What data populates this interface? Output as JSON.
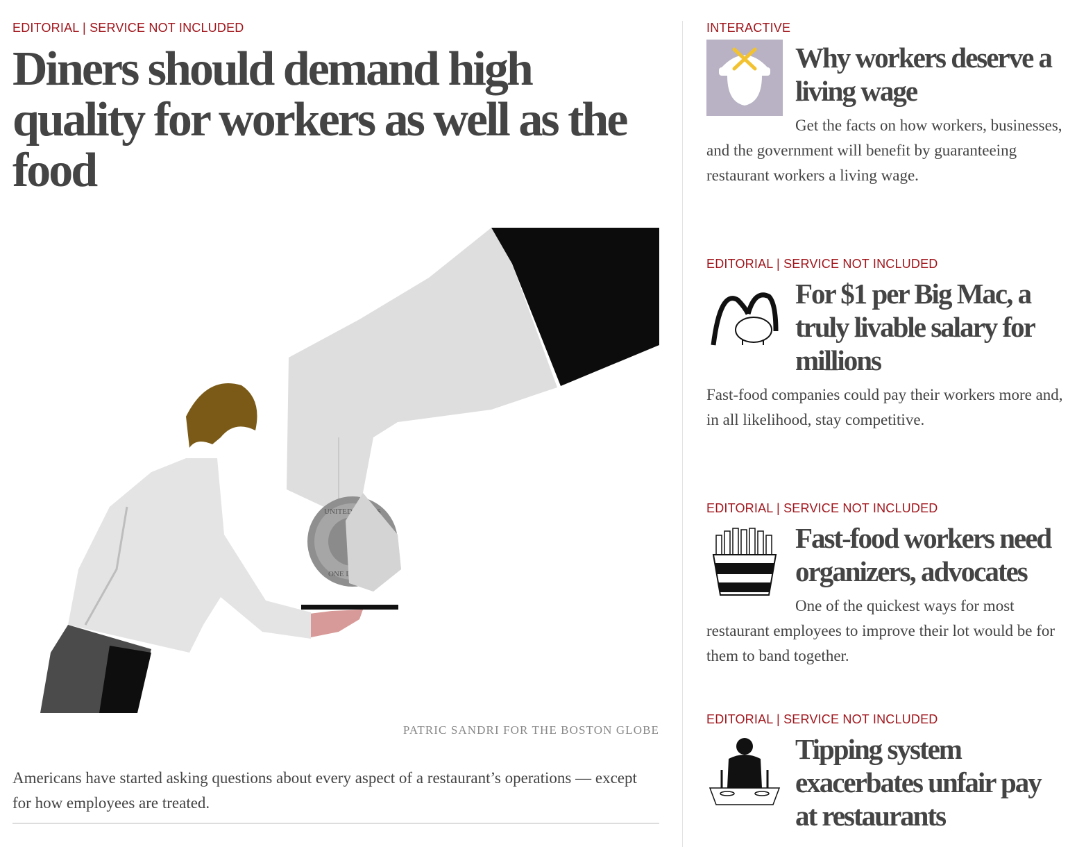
{
  "main": {
    "kicker": "EDITORIAL | SERVICE NOT INCLUDED",
    "headline": "Diners should demand high quality for workers as well as the food",
    "credit": "PATRIC SANDRI FOR THE BOSTON GLOBE",
    "summary": "Americans have started asking questions about every aspect of a restaurant’s operations — except for how employees are treated.",
    "coin_top": "UNITED STATES",
    "coin_bottom": "ONE DOLLAR"
  },
  "sidebar": [
    {
      "kicker": "INTERACTIVE",
      "title": "Why workers deserve a living wage",
      "blurb": "Get the facts on how workers, businesses, and the government will benefit by guaranteeing restaurant workers a living wage."
    },
    {
      "kicker": "EDITORIAL | SERVICE NOT INCLUDED",
      "title": "For $1 per Big Mac, a truly livable salary for millions",
      "blurb": "Fast-food companies could pay their workers more and, in all likelihood, stay competitive."
    },
    {
      "kicker": "EDITORIAL | SERVICE NOT INCLUDED",
      "title": "Fast-food workers need organizers, advocates",
      "blurb": "One of the quickest ways for most restaurant employees to improve their lot would be for them to band together."
    },
    {
      "kicker": "EDITORIAL | SERVICE NOT INCLUDED",
      "title": "Tipping system exacerbates unfair pay at restaurants"
    }
  ],
  "icons": {
    "thumb1": "plate-cloche-fork-knife-icon",
    "thumb2": "golden-arches-piggy-bank-icon",
    "thumb3": "fries-carton-raised-fists-icon",
    "thumb4": "diner-at-table-icon"
  },
  "colors": {
    "kicker": "#a0151b",
    "text": "#444444",
    "divider": "#e3e3e3",
    "thumb1_bg": "#b8b2c4",
    "thumb1_accent": "#f2c230"
  }
}
